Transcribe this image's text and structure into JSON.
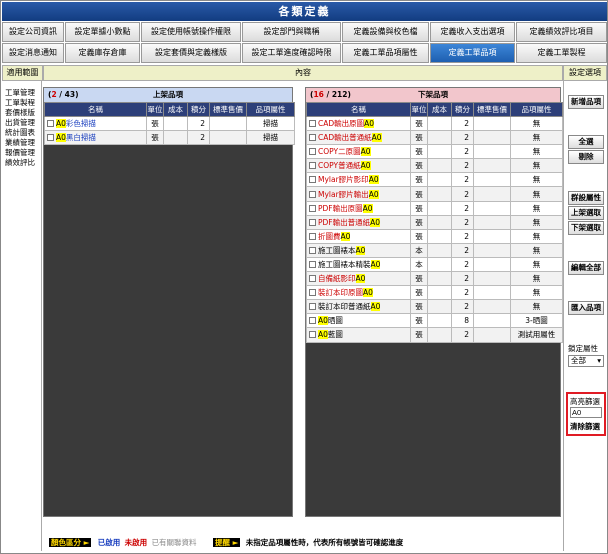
{
  "title": "各類定義",
  "tabs_row1": [
    "設定公司資訊",
    "設定單據小數點",
    "設定使用帳號操作權限",
    "設定部門與職稱",
    "定義設備與校色檔",
    "定義收入支出選項",
    "定義績效評比項目"
  ],
  "tabs_row2": [
    "設定消息通知",
    "定義庫存倉庫",
    "設定套價與定義樣版",
    "設定工單進度確認時限",
    "定義工單品項屬性",
    "定義工單品項",
    "定義工單製程"
  ],
  "header": {
    "left": "適用範圍",
    "center": "內容",
    "right": "設定選項"
  },
  "nav": [
    "工單管理",
    "工單製程",
    "套價樣版",
    "出貨管理",
    "統計圖表",
    "業績管理",
    "報價管理",
    "績效評比"
  ],
  "left_panel": {
    "shown": "2",
    "total": "43",
    "title": "上架品項",
    "columns": [
      "名稱",
      "單位",
      "成本",
      "積分",
      "標準售價",
      "品項屬性"
    ],
    "rows": [
      {
        "hl": "A0",
        "rest": "彩色掃描",
        "unit": "張",
        "cost": "",
        "points": "2",
        "price": "",
        "attr": "掃描"
      },
      {
        "hl": "A0",
        "rest": "黑白掃描",
        "unit": "張",
        "cost": "",
        "points": "2",
        "price": "",
        "attr": "掃描"
      }
    ]
  },
  "right_panel": {
    "shown": "16",
    "total": "212",
    "title": "下架品項",
    "columns": [
      "名稱",
      "單位",
      "成本",
      "積分",
      "標準售價",
      "品項屬性"
    ],
    "rows": [
      {
        "pre": "CAD輸出原圖",
        "hl": "A0",
        "post": "",
        "color": "red",
        "unit": "張",
        "cost": "",
        "points": "2",
        "price": "",
        "attr": "無"
      },
      {
        "pre": "CAD輸出普通紙",
        "hl": "A0",
        "post": "",
        "color": "red",
        "unit": "張",
        "cost": "",
        "points": "2",
        "price": "",
        "attr": "無"
      },
      {
        "pre": "COPY二原圖",
        "hl": "A0",
        "post": "",
        "color": "red",
        "unit": "張",
        "cost": "",
        "points": "2",
        "price": "",
        "attr": "無"
      },
      {
        "pre": "COPY普通紙",
        "hl": "A0",
        "post": "",
        "color": "red",
        "unit": "張",
        "cost": "",
        "points": "2",
        "price": "",
        "attr": "無"
      },
      {
        "pre": "Mylar膠片影印",
        "hl": "A0",
        "post": "",
        "color": "red",
        "unit": "張",
        "cost": "",
        "points": "2",
        "price": "",
        "attr": "無"
      },
      {
        "pre": "Mylar膠片輸出",
        "hl": "A0",
        "post": "",
        "color": "red",
        "unit": "張",
        "cost": "",
        "points": "2",
        "price": "",
        "attr": "無"
      },
      {
        "pre": "PDF輸出原圖",
        "hl": "A0",
        "post": "",
        "color": "red",
        "unit": "張",
        "cost": "",
        "points": "2",
        "price": "",
        "attr": "無"
      },
      {
        "pre": "PDF輸出普通紙",
        "hl": "A0",
        "post": "",
        "color": "red",
        "unit": "張",
        "cost": "",
        "points": "2",
        "price": "",
        "attr": "無"
      },
      {
        "pre": "折圖費",
        "hl": "A0",
        "post": "",
        "color": "red",
        "unit": "張",
        "cost": "",
        "points": "2",
        "price": "",
        "attr": "無"
      },
      {
        "pre": "施工圖裱本",
        "hl": "A0",
        "post": "",
        "color": "black",
        "unit": "本",
        "cost": "",
        "points": "2",
        "price": "",
        "attr": "無"
      },
      {
        "pre": "施工圖裱本精裝",
        "hl": "A0",
        "post": "",
        "color": "black",
        "unit": "本",
        "cost": "",
        "points": "2",
        "price": "",
        "attr": "無"
      },
      {
        "pre": "自備紙影印",
        "hl": "A0",
        "post": "",
        "color": "red",
        "unit": "張",
        "cost": "",
        "points": "2",
        "price": "",
        "attr": "無"
      },
      {
        "pre": "裝訂本印原圖",
        "hl": "A0",
        "post": "",
        "color": "red",
        "unit": "張",
        "cost": "",
        "points": "2",
        "price": "",
        "attr": "無"
      },
      {
        "pre": "裝訂本印普通紙",
        "hl": "A0",
        "post": "",
        "color": "black",
        "unit": "張",
        "cost": "",
        "points": "2",
        "price": "",
        "attr": "無"
      },
      {
        "pre": "",
        "hl": "A0",
        "post": "晒圖",
        "color": "black",
        "unit": "張",
        "cost": "",
        "points": "8",
        "price": "",
        "attr": "3-晒圖"
      },
      {
        "pre": "",
        "hl": "A0",
        "post": "藍圖",
        "color": "black",
        "unit": "張",
        "cost": "",
        "points": "2",
        "price": "",
        "attr": "測試用屬性"
      }
    ]
  },
  "options": {
    "new_item": "新增品項",
    "select_all": "全選",
    "deselect": "剔除",
    "group_attr": "群設屬性",
    "shelf_on": "上架選取",
    "shelf_off": "下架選取",
    "edit_all": "編輯全部",
    "import": "匯入品項",
    "lock_attr_label": "鎖定屬性",
    "lock_attr_value": "全部",
    "highlight_label": "高亮篩選",
    "highlight_value": "A0",
    "clear_filter": "清除篩選"
  },
  "legend": {
    "color_tag": "顏色區分",
    "enabled": "已啟用",
    "disabled": "未啟用",
    "linked": "已有關聯資料",
    "hint_tag": "提醒",
    "hint_text": "未指定品項屬性時，代表所有帳號皆可確認進度"
  },
  "colors": {
    "title_bg": "#1e4a92",
    "active_tab": "#2a72c8",
    "red_text": "#c00000",
    "highlight": "#ffff00",
    "highlight_box": "#e01b24"
  }
}
